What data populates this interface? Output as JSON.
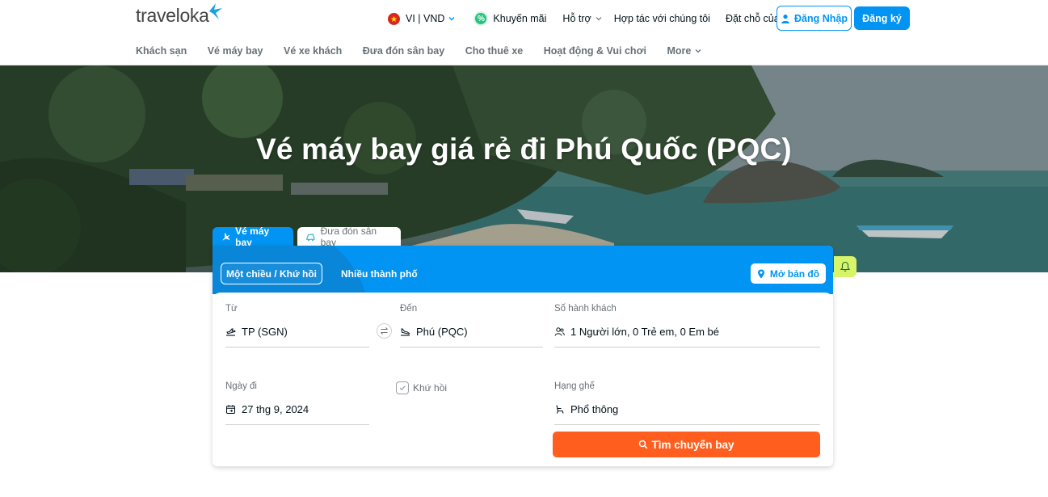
{
  "header": {
    "logo_text": "traveloka",
    "locale": "VI | VND",
    "promo": "Khuyến mãi",
    "support": "Hỗ trợ",
    "partner": "Hợp tác với chúng tôi",
    "bookings": "Đặt chỗ của tôi",
    "login": "Đăng Nhập",
    "register": "Đăng ký"
  },
  "nav": {
    "items": [
      "Khách sạn",
      "Vé máy bay",
      "Vé xe khách",
      "Đưa đón sân bay",
      "Cho thuê xe",
      "Hoạt động & Vui chơi",
      "More"
    ]
  },
  "hero": {
    "title": "Vé máy bay giá rẻ đi Phú Quốc (PQC)"
  },
  "tabs": {
    "flight": "Vé máy bay",
    "transfer": "Đưa đón sân bay"
  },
  "search": {
    "mode_oneway": "Một chiều / Khứ hồi",
    "mode_multi": "Nhiều thành phố",
    "map_button": "Mở bản đồ",
    "from_label": "Từ",
    "from_value": "TP (SGN)",
    "to_label": "Đến",
    "to_value": "Phú (PQC)",
    "pax_label": "Số hành khách",
    "pax_value": "1 Người lớn, 0 Trẻ em, 0 Em bé",
    "date_label": "Ngày đi",
    "date_value": "27 thg 9, 2024",
    "return_label": "Khứ hồi",
    "return_checked": true,
    "class_label": "Hạng ghế",
    "class_value": "Phổ thông",
    "search_button": "Tìm chuyến bay"
  },
  "colors": {
    "brand_blue": "#0194f3",
    "search_orange": "#ff5e1f",
    "bell_green": "#d8f56a"
  }
}
